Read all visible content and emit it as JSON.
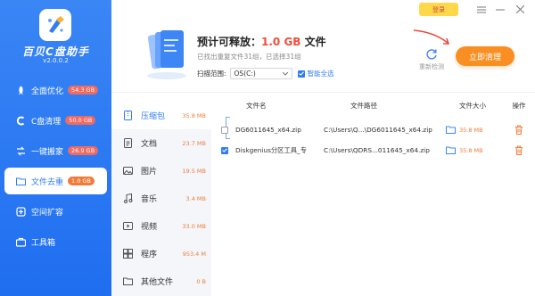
{
  "app": {
    "name": "百贝C盘助手",
    "version": "v2.0.0.2"
  },
  "titlebar": {
    "login_label": "登录",
    "menu_icon": "hamburger-icon",
    "minimize_icon": "minimize-icon",
    "close_icon": "close-icon"
  },
  "sidebar": {
    "items": [
      {
        "label": "全面优化",
        "badge": "54.3 GB",
        "icon": "rocket-icon"
      },
      {
        "label": "C盘清理",
        "badge": "50.0 GB",
        "icon": "c-drive-icon"
      },
      {
        "label": "一键搬家",
        "badge": "26.9 GB",
        "icon": "move-icon"
      },
      {
        "label": "文件去重",
        "badge": "1.0 GB",
        "icon": "folder-icon",
        "active": true
      },
      {
        "label": "空间扩容",
        "badge": "",
        "icon": "expand-icon"
      },
      {
        "label": "工具箱",
        "badge": "",
        "icon": "toolbox-icon"
      }
    ]
  },
  "header": {
    "title_prefix": "预计可释放：",
    "title_value": "1.0 GB",
    "title_suffix": " 文件",
    "subtitle": "已找出重复文件31组，已选择31组",
    "scan_label": "扫描范围:",
    "scan_value": "OS(C:)",
    "smart_select_label": "智能全选",
    "rescan_label": "重新检测",
    "clean_button": "立即清理"
  },
  "categories": [
    {
      "label": "压缩包",
      "size": "35.8 MB",
      "icon": "archive-icon",
      "active": true
    },
    {
      "label": "文档",
      "size": "23.7 MB",
      "icon": "document-icon"
    },
    {
      "label": "图片",
      "size": "19.5 MB",
      "icon": "image-icon"
    },
    {
      "label": "音乐",
      "size": "3.4 MB",
      "icon": "music-icon"
    },
    {
      "label": "视频",
      "size": "33.0 MB",
      "icon": "video-icon"
    },
    {
      "label": "程序",
      "size": "953.4 M",
      "icon": "program-icon"
    },
    {
      "label": "其他文件",
      "size": "0 B",
      "icon": "other-file-icon"
    }
  ],
  "table": {
    "headers": {
      "name": "文件名",
      "path": "文件路径",
      "size": "文件大小",
      "op": "操作"
    },
    "rows": [
      {
        "name": "DG6011645_x64.zip",
        "path": "C:\\Users\\Q...\\DG6011645_x64.zip",
        "size": "35.8 MB",
        "checked": false
      },
      {
        "name": "Diskgenius分区工具_专",
        "path": "C:\\Users\\QDRS...011645_x64.zip",
        "size": "35.8 MB",
        "checked": true
      }
    ]
  },
  "colors": {
    "sidebar": "#2f7df4",
    "accent_orange": "#f98f22",
    "highlight_red": "#f04d3a",
    "badge_red": "#f06b62"
  }
}
